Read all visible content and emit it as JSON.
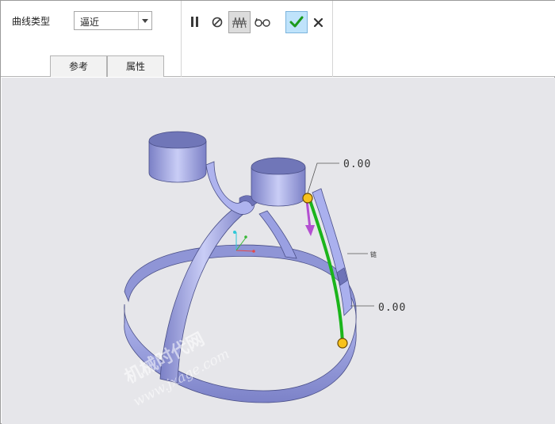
{
  "toolbar": {
    "curve_type_label": "曲线类型",
    "curve_type_value": "逼近",
    "tabs": [
      "参考",
      "属性"
    ]
  },
  "viewport": {
    "dim_top": "0.00",
    "dim_bottom": "0.00",
    "side_label": "链",
    "watermark": {
      "line1": "机械时代网",
      "line2": "www.jxage.com"
    }
  },
  "colors": {
    "surface": "#9ca3e6",
    "surface_dark": "#5a5f9a",
    "curve": "#1bb51b",
    "arrow": "#b34fd1",
    "endpoint": "#f7c21c",
    "ok_bg": "#bfe3fb",
    "check": "#1c9a1c"
  },
  "icons": {
    "pause": "pause-icon",
    "no_preview": "no-preview-icon",
    "verify": "verify-mode-icon",
    "glasses": "glasses-preview-icon",
    "ok": "checkmark-icon",
    "cancel": "close-icon"
  }
}
